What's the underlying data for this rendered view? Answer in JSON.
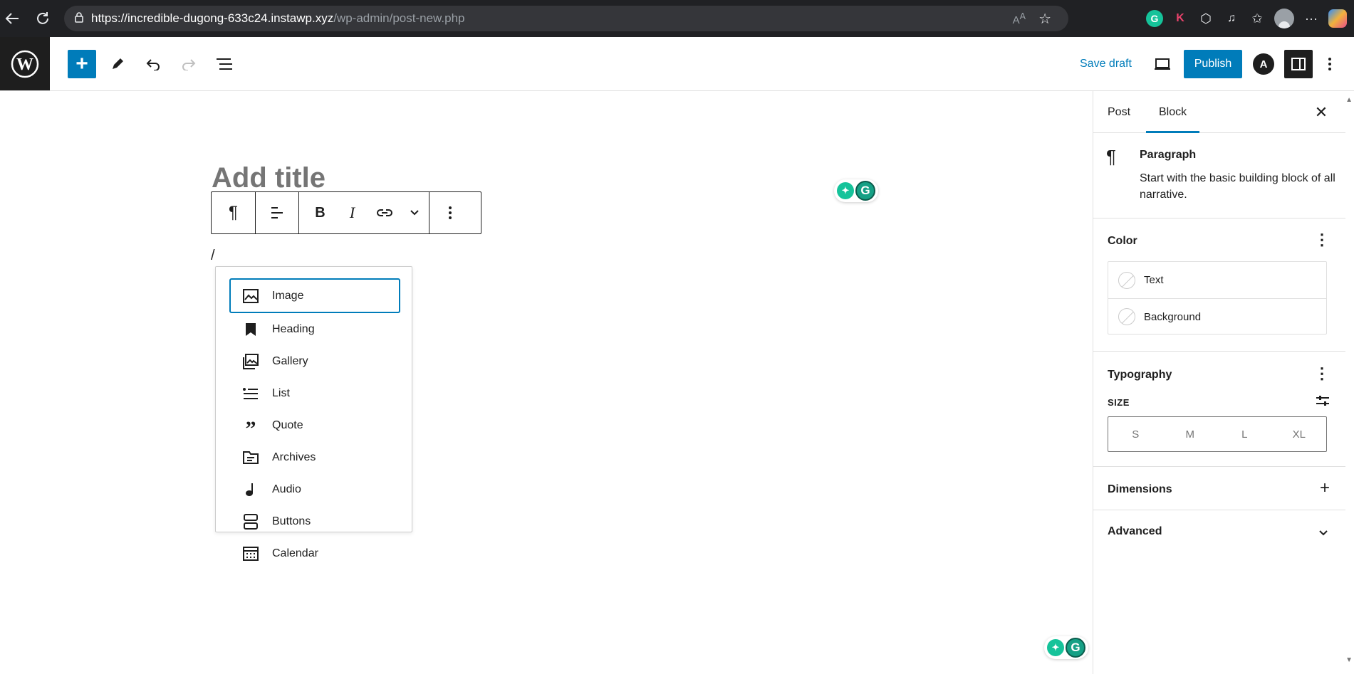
{
  "browser": {
    "url_host": "https://incredible-dugong-633c24.instawp.xyz",
    "url_path": "/wp-admin/post-new.php"
  },
  "toolbar": {
    "save_draft": "Save draft",
    "publish": "Publish"
  },
  "editor": {
    "title_placeholder": "Add title",
    "slash_text": "/"
  },
  "inserter": {
    "items": [
      {
        "label": "Image",
        "icon": "image-icon"
      },
      {
        "label": "Heading",
        "icon": "heading-icon"
      },
      {
        "label": "Gallery",
        "icon": "gallery-icon"
      },
      {
        "label": "List",
        "icon": "list-icon"
      },
      {
        "label": "Quote",
        "icon": "quote-icon"
      },
      {
        "label": "Archives",
        "icon": "archives-icon"
      },
      {
        "label": "Audio",
        "icon": "audio-icon"
      },
      {
        "label": "Buttons",
        "icon": "buttons-icon"
      },
      {
        "label": "Calendar",
        "icon": "calendar-icon"
      }
    ]
  },
  "sidebar": {
    "tabs": {
      "post": "Post",
      "block": "Block"
    },
    "block_card": {
      "title": "Paragraph",
      "description": "Start with the basic building block of all narrative."
    },
    "color": {
      "title": "Color",
      "text": "Text",
      "background": "Background"
    },
    "typography": {
      "title": "Typography",
      "size_label": "SIZE",
      "sizes": [
        "S",
        "M",
        "L",
        "XL"
      ]
    },
    "dimensions": {
      "title": "Dimensions"
    },
    "advanced": {
      "title": "Advanced"
    }
  },
  "colors": {
    "accent": "#007cba",
    "dark": "#1e1e1e",
    "grammarly": "#15c39a"
  }
}
